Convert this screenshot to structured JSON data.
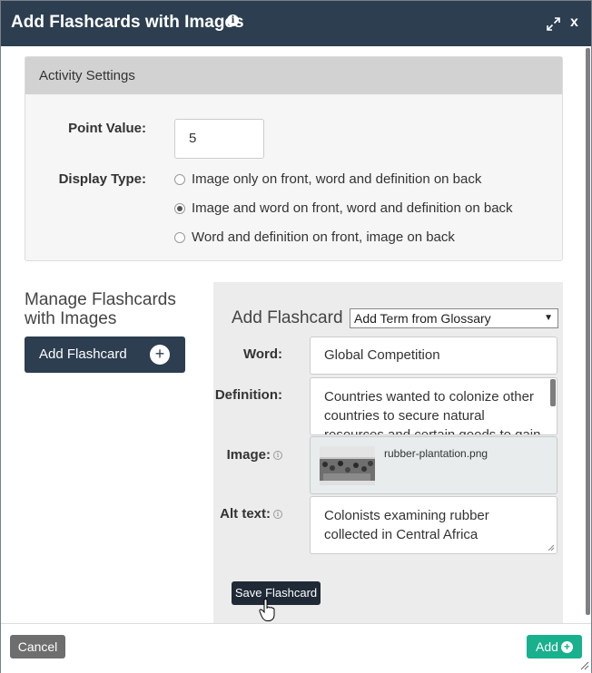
{
  "dialog": {
    "title": "Add Flashcards with Images",
    "close_label": "x"
  },
  "settings": {
    "header": "Activity Settings",
    "point_value_label": "Point Value:",
    "point_value": "5",
    "display_type_label": "Display Type:",
    "display_options": [
      {
        "label": "Image only on front, word and definition on back",
        "selected": false
      },
      {
        "label": "Image and word on front, word and definition on back",
        "selected": true
      },
      {
        "label": "Word and definition on front, image on back",
        "selected": false
      }
    ]
  },
  "manage": {
    "title": "Manage Flashcards with Images",
    "add_button": "Add Flashcard"
  },
  "form": {
    "title": "Add Flashcard",
    "glossary_select": "Add Term from Glossary",
    "word_label": "Word:",
    "word_value": "Global Competition",
    "definition_label": "Definition:",
    "definition_value": "Countries wanted to colonize other countries to secure natural resources and certain goods to gain",
    "image_label": "Image:",
    "image_filename": "rubber-plantation.png",
    "alt_label": "Alt text:",
    "alt_value": "Colonists examining rubber collected in Central Africa",
    "save_button": "Save Flashcard"
  },
  "footer": {
    "cancel": "Cancel",
    "add": "Add"
  },
  "colors": {
    "titlebar": "#2c3e50",
    "add_button": "#18b08d",
    "cancel_button": "#6e6e6e"
  }
}
